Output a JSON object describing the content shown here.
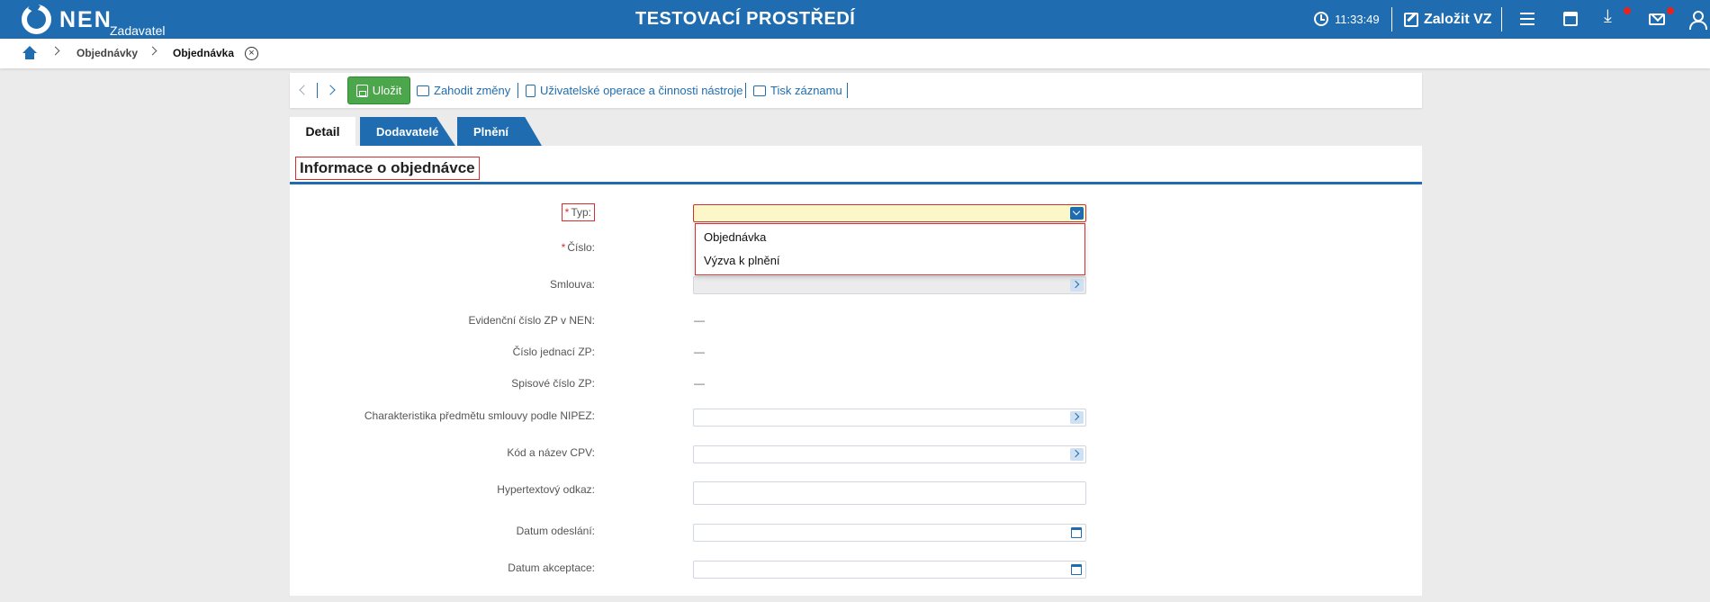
{
  "header": {
    "brand": "NEN",
    "brand_sub": "Zadavatel",
    "environment": "TESTOVACÍ PROSTŘEDÍ",
    "time": "11:33:49",
    "create_label": "Založit VZ",
    "accent_color": "#1f6db0",
    "icons": [
      "clock-icon",
      "pencil-icon",
      "menu-icon",
      "calendar-icon",
      "download-icon",
      "mail-icon",
      "user-icon"
    ]
  },
  "breadcrumb": {
    "items": [
      "Objednávky",
      "Objednávka"
    ]
  },
  "toolbar": {
    "save_label": "Uložit",
    "discard_label": "Zahodit změny",
    "user_ops_label": "Uživatelské operace a činnosti nástroje",
    "print_label": "Tisk záznamu"
  },
  "tabs": [
    {
      "label": "Detail",
      "active": true
    },
    {
      "label": "Dodavatelé",
      "active": false
    },
    {
      "label": "Plnění",
      "active": false
    }
  ],
  "section": {
    "title": "Informace o objednávce"
  },
  "form": {
    "typ_label": "Typ:",
    "typ_value": "",
    "cislo_label": "Číslo:",
    "smlouva_label": "Smlouva:",
    "evidencni_label": "Evidenční číslo ZP v NEN:",
    "evidencni_value": "—",
    "jednaci_label": "Číslo jednací ZP:",
    "jednaci_value": "—",
    "spisove_label": "Spisové číslo ZP:",
    "spisove_value": "—",
    "nipez_label": "Charakteristika předmětu smlouvy podle NIPEZ:",
    "cpv_label": "Kód a název CPV:",
    "odkaz_label": "Hypertextový odkaz:",
    "odeslani_label": "Datum odeslání:",
    "akceptace_label": "Datum akceptace:",
    "required_mark": "*"
  },
  "typ_dropdown": {
    "options": [
      "Objednávka",
      "Výzva k plnění"
    ]
  }
}
